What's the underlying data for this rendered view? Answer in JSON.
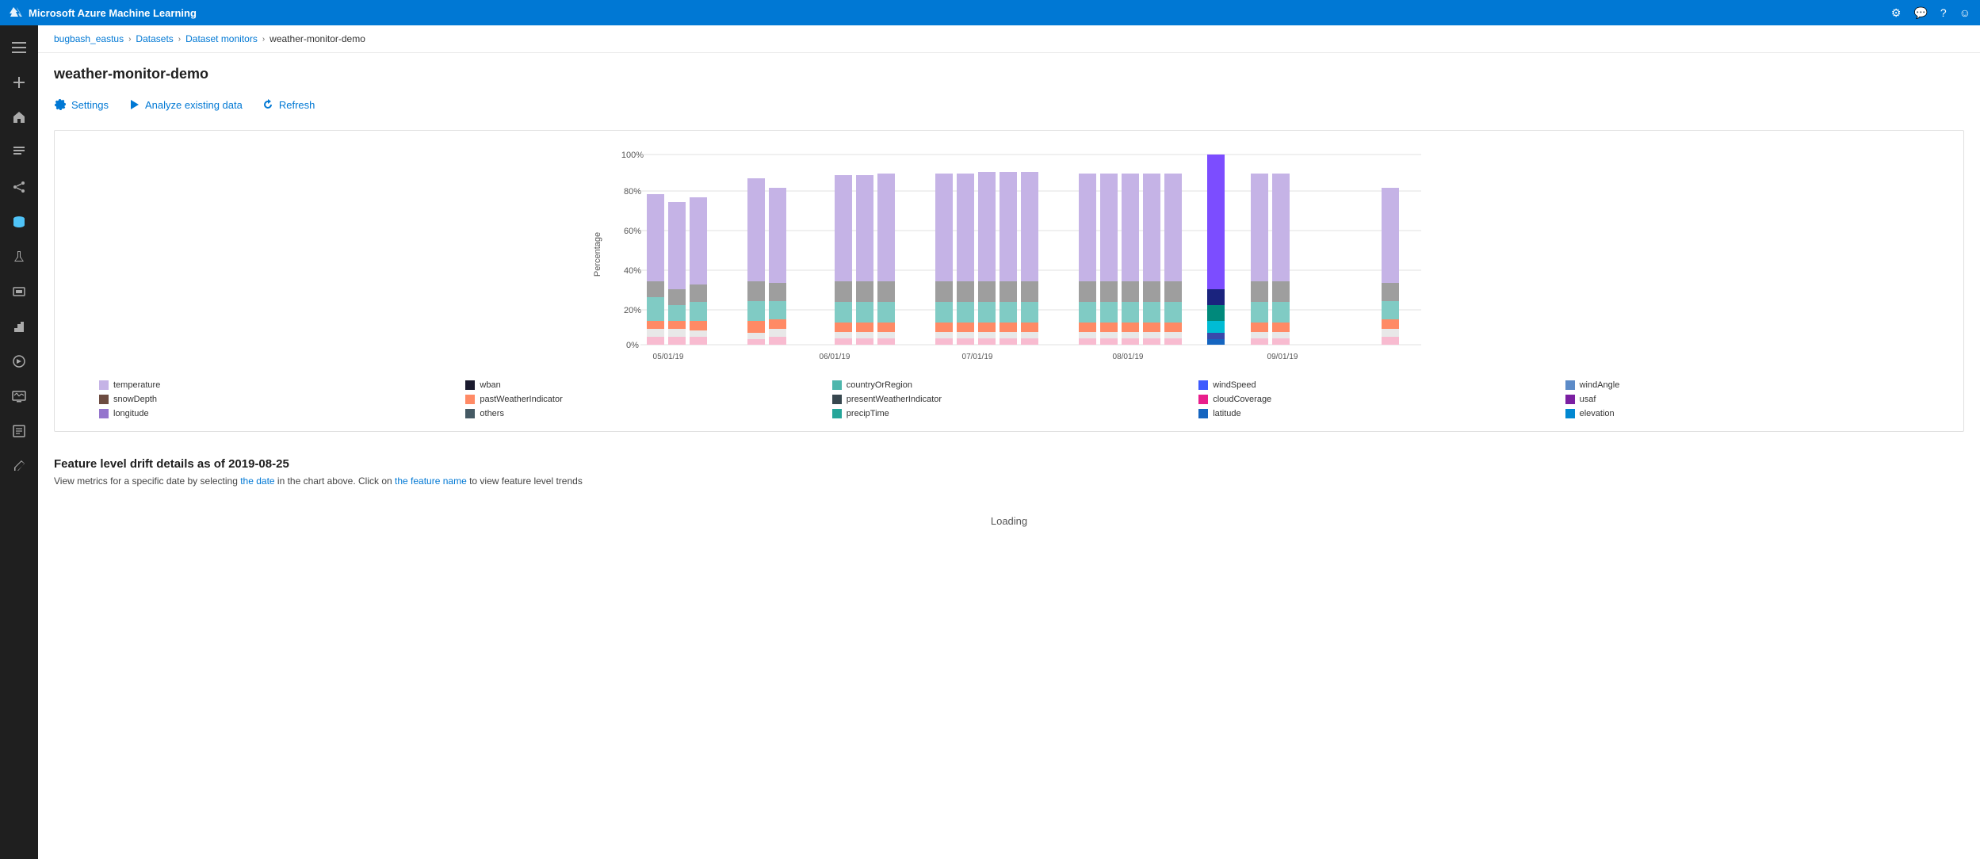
{
  "topbar": {
    "title": "Microsoft Azure Machine Learning",
    "icons": [
      "settings-icon",
      "feedback-icon",
      "help-icon",
      "account-icon"
    ]
  },
  "breadcrumb": {
    "workspace": "bugbash_eastus",
    "datasets": "Datasets",
    "monitors": "Dataset monitors",
    "current": "weather-monitor-demo"
  },
  "page": {
    "title": "weather-monitor-demo"
  },
  "toolbar": {
    "settings_label": "Settings",
    "analyze_label": "Analyze existing data",
    "refresh_label": "Refresh"
  },
  "chart": {
    "y_labels": [
      "0%",
      "20%",
      "40%",
      "60%",
      "80%",
      "100%"
    ],
    "y_axis_label": "Percentage",
    "x_labels": [
      "05/01/19",
      "06/01/19",
      "07/01/19",
      "08/01/19",
      "09/01/19"
    ]
  },
  "legend": [
    {
      "label": "temperature",
      "color": "#c5b3e6"
    },
    {
      "label": "wban",
      "color": "#1a1a2e"
    },
    {
      "label": "countryOrRegion",
      "color": "#4db6ac"
    },
    {
      "label": "windSpeed",
      "color": "#3d5afe"
    },
    {
      "label": "windAngle",
      "color": "#5c8bc8"
    },
    {
      "label": "snowDepth",
      "color": "#6d4c41"
    },
    {
      "label": "pastWeatherIndicator",
      "color": "#ff8a65"
    },
    {
      "label": "presentWeatherIndicator",
      "color": "#37474f"
    },
    {
      "label": "cloudCoverage",
      "color": "#e91e8c"
    },
    {
      "label": "usaf",
      "color": "#7b1fa2"
    },
    {
      "label": "longitude",
      "color": "#9575cd"
    },
    {
      "label": "others",
      "color": "#37474f"
    },
    {
      "label": "precipTime",
      "color": "#26a69a"
    },
    {
      "label": "latitude",
      "color": "#1565c0"
    },
    {
      "label": "elevation",
      "color": "#0288d1"
    }
  ],
  "feature_section": {
    "title": "Feature level drift details as of 2019-08-25",
    "subtitle": "View metrics for a specific date by selecting the date in the chart above. Click on the feature name to view feature level trends",
    "loading_text": "Loading"
  },
  "sidebar_items": [
    {
      "name": "home-icon",
      "symbol": "⌂"
    },
    {
      "name": "assets-icon",
      "symbol": "≡"
    },
    {
      "name": "pipelines-icon",
      "symbol": "⑇"
    },
    {
      "name": "models-icon",
      "symbol": "⬡"
    },
    {
      "name": "datasets-icon",
      "symbol": "⬢",
      "active": true
    },
    {
      "name": "experiments-icon",
      "symbol": "⚗"
    },
    {
      "name": "compute-icon",
      "symbol": "☰"
    },
    {
      "name": "deploy-icon",
      "symbol": "▦"
    },
    {
      "name": "cloud-icon",
      "symbol": "☁"
    },
    {
      "name": "monitor-icon",
      "symbol": "◫"
    },
    {
      "name": "logs-icon",
      "symbol": "☷"
    },
    {
      "name": "edit-icon",
      "symbol": "✎"
    }
  ]
}
